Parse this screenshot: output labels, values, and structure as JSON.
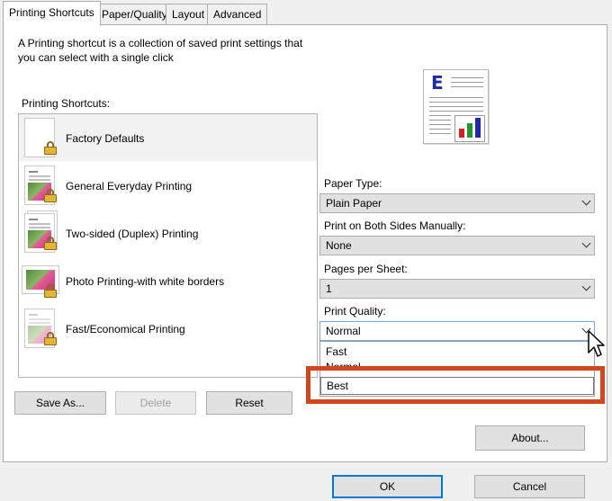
{
  "tabs": [
    {
      "label": "Printing Shortcuts",
      "active": true
    },
    {
      "label": "Paper/Quality",
      "active": false
    },
    {
      "label": "Layout",
      "active": false
    },
    {
      "label": "Advanced",
      "active": false
    }
  ],
  "intro_text": "A Printing shortcut is a collection of saved print settings that you can select with a single click",
  "shortcuts": {
    "heading": "Printing Shortcuts:",
    "items": [
      {
        "label": "Factory Defaults",
        "icon": "blank-page-icon",
        "selected": true
      },
      {
        "label": "General Everyday Printing",
        "icon": "photo-page-icon",
        "selected": false
      },
      {
        "label": "Two-sided (Duplex) Printing",
        "icon": "duplex-pages-icon",
        "selected": false
      },
      {
        "label": "Photo Printing-with white borders",
        "icon": "photo-landscape-icon",
        "selected": false
      },
      {
        "label": "Fast/Economical Printing",
        "icon": "faded-photo-page-icon",
        "selected": false
      }
    ],
    "lock_icon": "lock-icon",
    "buttons": {
      "save_as": "Save As...",
      "delete": "Delete",
      "reset": "Reset"
    }
  },
  "settings": {
    "paper_type": {
      "label": "Paper Type:",
      "value": "Plain Paper"
    },
    "both_sides": {
      "label": "Print on Both Sides Manually:",
      "value": "None"
    },
    "pages_per_sheet": {
      "label": "Pages per Sheet:",
      "value": "1"
    },
    "print_quality": {
      "label": "Print Quality:",
      "value": "Normal",
      "options": [
        "Fast",
        "Normal",
        "Best"
      ],
      "highlighted_option": "Best"
    }
  },
  "about_button": "About...",
  "footer": {
    "ok": "OK",
    "cancel": "Cancel"
  },
  "colors": {
    "annotation": "#d2461f",
    "preview_letter": "#1f2aa8"
  }
}
